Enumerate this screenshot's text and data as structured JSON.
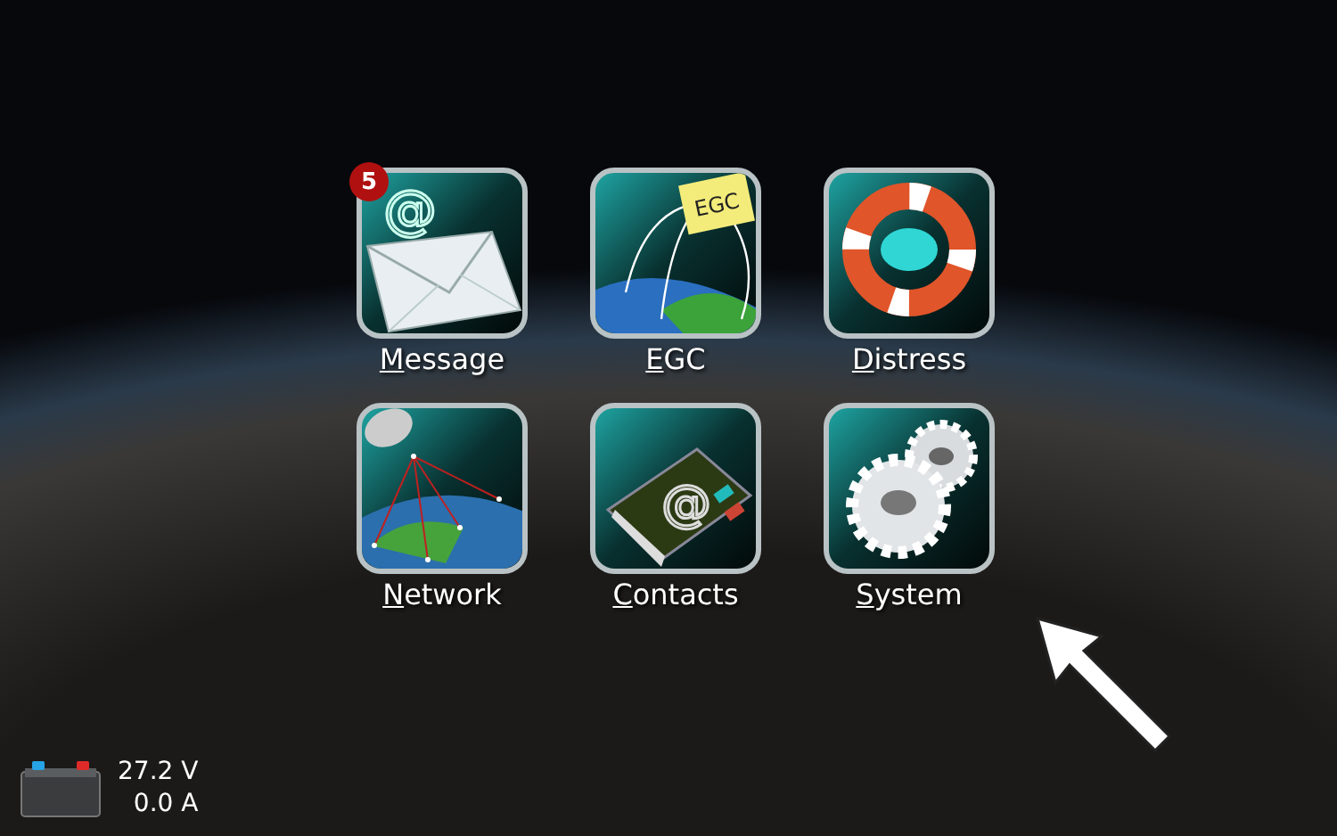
{
  "apps": [
    {
      "kind": "message",
      "label": "Message",
      "badge": "5",
      "symbol": "@"
    },
    {
      "kind": "egc",
      "label": "EGC",
      "note_text": "EGC"
    },
    {
      "kind": "distress",
      "label": "Distress"
    },
    {
      "kind": "network",
      "label": "Network"
    },
    {
      "kind": "contacts",
      "label": "Contacts",
      "symbol": "@"
    },
    {
      "kind": "system",
      "label": "System"
    }
  ],
  "power": {
    "voltage": "27.2 V",
    "current": "0.0 A"
  }
}
